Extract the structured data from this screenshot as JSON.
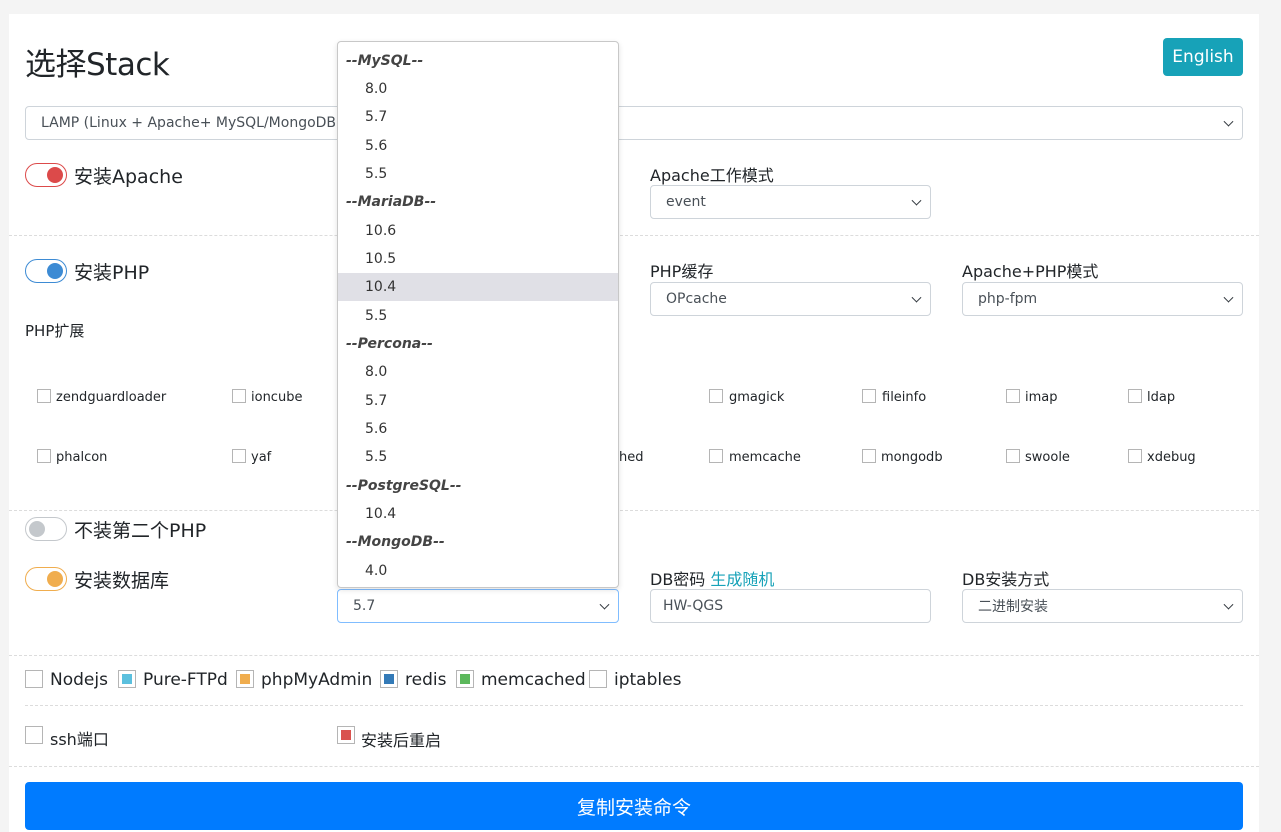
{
  "header": {
    "title": "选择Stack",
    "language_button": "English"
  },
  "stack_select": {
    "value": "LAMP (Linux + Apache+ MySQL/MongoDB + PHP)"
  },
  "apache": {
    "label": "安装Apache",
    "mode_label": "Apache工作模式",
    "mode_value": "event"
  },
  "php": {
    "label": "安装PHP",
    "cache_label": "PHP缓存",
    "cache_value": "OPcache",
    "mode_label": "Apache+PHP模式",
    "mode_value": "php-fpm",
    "ext_label": "PHP扩展",
    "ext_row1": [
      "zendguardloader",
      "ioncube",
      "gmagick",
      "fileinfo",
      "imap",
      "ldap"
    ],
    "ext_row2": [
      "phalcon",
      "yaf",
      "hed",
      "memcache",
      "mongodb",
      "swoole",
      "xdebug"
    ]
  },
  "php2": {
    "label": "不装第二个PHP"
  },
  "db": {
    "label": "安装数据库",
    "version_value": "5.7",
    "pwd_label": "DB密码",
    "pwd_link": "生成随机",
    "pwd_value": "HW-QGS",
    "method_label": "DB安装方式",
    "method_value": "二进制安装"
  },
  "dropdown": {
    "groups": [
      "--MySQL--",
      "--MariaDB--",
      "--Percona--",
      "--PostgreSQL--",
      "--MongoDB--"
    ],
    "mysql": [
      "8.0",
      "5.7",
      "5.6",
      "5.5"
    ],
    "mariadb": [
      "10.6",
      "10.5",
      "10.4",
      "5.5"
    ],
    "percona": [
      "8.0",
      "5.7",
      "5.6",
      "5.5"
    ],
    "postgresql": [
      "10.4"
    ],
    "mongodb": [
      "4.0"
    ]
  },
  "extras": [
    "Nodejs",
    "Pure-FTPd",
    "phpMyAdmin",
    "redis",
    "memcached",
    "iptables"
  ],
  "options": {
    "ssh": "ssh端口",
    "reboot": "安装后重启"
  },
  "copy_button": "复制安装命令",
  "colors": {
    "apache_toggle": "#dc4a4a",
    "php_toggle": "#3d8bd4",
    "php2_toggle": "#c4c8cc",
    "db_toggle": "#f0ad4e",
    "pureftpd": "#5bc0de",
    "phpmyadmin": "#f0ad4e",
    "redis": "#337ab7",
    "memcached": "#5cb85c",
    "reboot": "#d9534f",
    "primary": "#007bff",
    "info": "#17a2b8"
  }
}
